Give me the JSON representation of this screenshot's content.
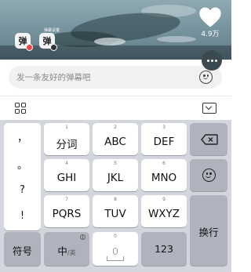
{
  "video": {
    "overlay_text": "弹幕设置",
    "danmu_toggle_glyph": "弹",
    "danmu_setting_glyph": "弹"
  },
  "like": {
    "count": "4.9万"
  },
  "comment": {
    "placeholder": "发一条友好的弹幕吧"
  },
  "keyboard": {
    "punctuation": [
      "，",
      "。",
      "?",
      "!"
    ],
    "rows": [
      [
        {
          "num": "1",
          "label": "分词"
        },
        {
          "num": "2",
          "label": "ABC"
        },
        {
          "num": "3",
          "label": "DEF"
        }
      ],
      [
        {
          "num": "4",
          "label": "GHI"
        },
        {
          "num": "5",
          "label": "JKL"
        },
        {
          "num": "6",
          "label": "MNO"
        }
      ],
      [
        {
          "num": "7",
          "label": "PQRS"
        },
        {
          "num": "8",
          "label": "TUV"
        },
        {
          "num": "9",
          "label": "WXYZ"
        }
      ]
    ],
    "symbols_label": "符号",
    "lang_main": "中",
    "lang_alt": "/英",
    "space_num": "0",
    "numbers_label": "123",
    "enter_label": "换行"
  },
  "colors": {
    "keyboard_bg": "#d3d6dc",
    "key_dark": "#aeb3bd",
    "key_light": "#ffffff"
  }
}
